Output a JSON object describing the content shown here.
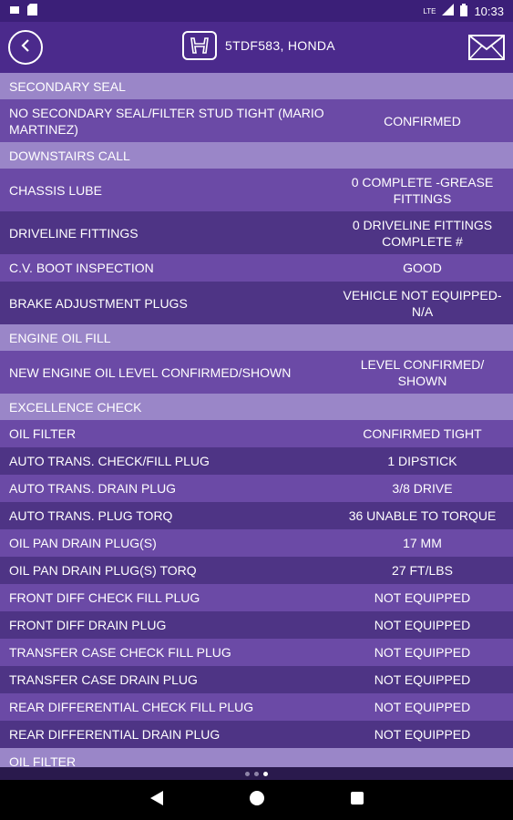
{
  "statusbar": {
    "time": "10:33",
    "lte": "LTE"
  },
  "header": {
    "title": "5TDF583,  HONDA"
  },
  "rows": [
    {
      "type": "section",
      "label": "SECONDARY SEAL"
    },
    {
      "type": "item",
      "size": "tall",
      "label": "NO SECONDARY SEAL/FILTER STUD TIGHT (MARIO MARTINEZ)",
      "value": "CONFIRMED"
    },
    {
      "type": "section",
      "label": "DOWNSTAIRS CALL"
    },
    {
      "type": "item",
      "size": "tall",
      "label": "CHASSIS LUBE",
      "value": "0 COMPLETE -GREASE FITTINGS"
    },
    {
      "type": "item",
      "size": "tall",
      "label": "DRIVELINE FITTINGS",
      "value": "0 DRIVELINE FITTINGS COMPLETE #"
    },
    {
      "type": "item",
      "size": "short",
      "label": "C.V. BOOT INSPECTION",
      "value": "GOOD"
    },
    {
      "type": "item",
      "size": "tall",
      "label": "BRAKE ADJUSTMENT PLUGS",
      "value": "VEHICLE NOT EQUIPPED-N/A"
    },
    {
      "type": "section",
      "label": "ENGINE OIL FILL"
    },
    {
      "type": "item",
      "size": "tall",
      "label": "NEW  ENGINE OIL LEVEL CONFIRMED/SHOWN",
      "value": "LEVEL CONFIRMED/ SHOWN"
    },
    {
      "type": "section",
      "label": "EXCELLENCE CHECK"
    },
    {
      "type": "item",
      "size": "short",
      "label": "OIL FILTER",
      "value": "CONFIRMED TIGHT"
    },
    {
      "type": "item",
      "size": "short",
      "label": "AUTO TRANS. CHECK/FILL PLUG",
      "value": "1 DIPSTICK"
    },
    {
      "type": "item",
      "size": "short",
      "label": "AUTO TRANS. DRAIN PLUG",
      "value": "3/8 DRIVE"
    },
    {
      "type": "item",
      "size": "short",
      "label": "AUTO TRANS. PLUG TORQ",
      "value": "36 UNABLE TO TORQUE"
    },
    {
      "type": "item",
      "size": "short",
      "label": "OIL PAN DRAIN PLUG(S)",
      "value": "17 MM"
    },
    {
      "type": "item",
      "size": "short",
      "label": "OIL PAN DRAIN PLUG(S) TORQ",
      "value": "27 FT/LBS"
    },
    {
      "type": "item",
      "size": "short",
      "label": "FRONT DIFF CHECK FILL PLUG",
      "value": "NOT EQUIPPED"
    },
    {
      "type": "item",
      "size": "short",
      "label": "FRONT DIFF DRAIN PLUG",
      "value": "NOT EQUIPPED"
    },
    {
      "type": "item",
      "size": "short",
      "label": "TRANSFER CASE CHECK FILL PLUG",
      "value": "NOT EQUIPPED"
    },
    {
      "type": "item",
      "size": "short",
      "label": "TRANSFER CASE DRAIN PLUG",
      "value": "NOT EQUIPPED"
    },
    {
      "type": "item",
      "size": "short",
      "label": "REAR DIFFERENTIAL CHECK FILL PLUG",
      "value": "NOT EQUIPPED"
    },
    {
      "type": "item",
      "size": "short",
      "label": "REAR DIFFERENTIAL DRAIN PLUG",
      "value": "NOT EQUIPPED"
    },
    {
      "type": "section",
      "label": "OIL FILTER"
    }
  ],
  "pager": {
    "count": 3,
    "active": 2
  },
  "icons": {
    "back": "back-arrow-icon",
    "logo": "honda-logo-icon",
    "mail": "mail-icon"
  },
  "colors": {
    "section": "#9a86c8",
    "row_odd": "#6b4aa6",
    "row_even": "#4e3485",
    "appbar": "#4b2a8c"
  }
}
